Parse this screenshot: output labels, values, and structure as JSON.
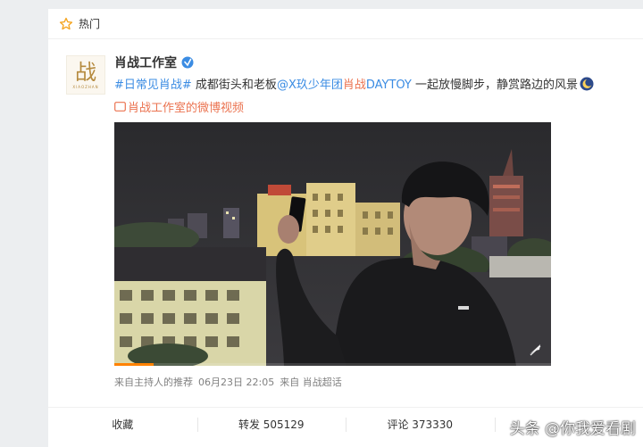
{
  "header": {
    "hot_label": "热门",
    "icon": "star-icon"
  },
  "author": {
    "name": "肖战工作室",
    "avatar_glyph": "战",
    "avatar_sub": "XIAOZHAN",
    "verified": true
  },
  "post": {
    "topic1": "#日常见肖战#",
    "text1": " 成都街头和老板",
    "mention1": "@X玖少年团",
    "mention1_link": "肖战",
    "mention1_tail": "DAYTOY",
    "text2": " 一起放慢脚步，静赏路边的风景",
    "video_link": "肖战工作室的微博视频"
  },
  "video": {
    "progress": 0.09,
    "icon": "video-settings-icon"
  },
  "meta": {
    "source": "来自主持人的推荐",
    "time": "06月23日 22:05",
    "from": "来自 肖战超话"
  },
  "actions": {
    "collect": "收藏",
    "repost": "转发 505129",
    "comment": "评论 373330",
    "like": ""
  },
  "watermark": "头条 @你我爱看剧",
  "colors": {
    "link": "#eb7350",
    "mention": "#3b8ce3",
    "accent": "#ff8200"
  }
}
